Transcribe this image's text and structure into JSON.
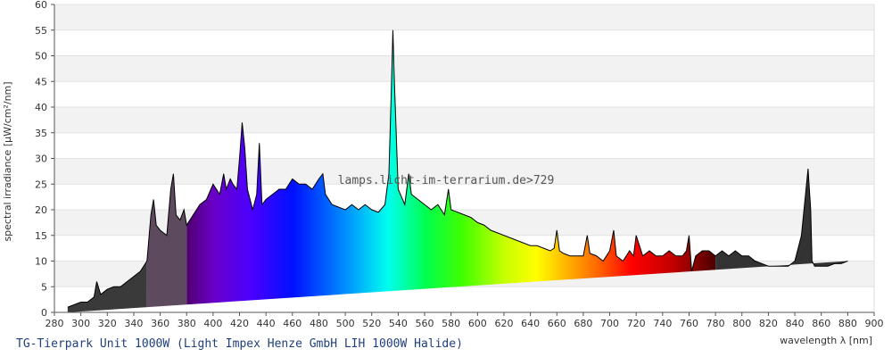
{
  "chart_data": {
    "type": "area",
    "xlabel": "wavelength λ [nm]",
    "ylabel": "spectral irradiance [µW/cm²/nm]",
    "xlim": [
      280,
      900
    ],
    "ylim": [
      0,
      60
    ],
    "x_ticks": [
      280,
      300,
      320,
      340,
      360,
      380,
      400,
      420,
      440,
      460,
      480,
      500,
      520,
      540,
      560,
      580,
      600,
      620,
      640,
      660,
      680,
      700,
      720,
      740,
      760,
      780,
      800,
      820,
      840,
      860,
      880,
      900
    ],
    "y_ticks": [
      0,
      5,
      10,
      15,
      20,
      25,
      30,
      35,
      40,
      45,
      50,
      55,
      60
    ],
    "grid": true,
    "watermark": "lamps.licht-im-terrarium.de>729",
    "caption": "TG-Tierpark Unit 1000W (Light Impex Henze GmbH LIH 1000W Halide)",
    "x": [
      290,
      295,
      300,
      305,
      310,
      312,
      315,
      320,
      325,
      330,
      335,
      340,
      345,
      350,
      353,
      355,
      357,
      360,
      365,
      368,
      370,
      372,
      375,
      378,
      380,
      385,
      390,
      395,
      400,
      405,
      408,
      410,
      413,
      415,
      418,
      420,
      422,
      424,
      426,
      430,
      433,
      435,
      437,
      440,
      445,
      450,
      455,
      460,
      465,
      470,
      475,
      480,
      483,
      485,
      490,
      495,
      500,
      505,
      510,
      515,
      520,
      525,
      530,
      533,
      535,
      536,
      537,
      540,
      545,
      548,
      550,
      555,
      560,
      565,
      570,
      575,
      578,
      580,
      585,
      590,
      595,
      600,
      605,
      610,
      615,
      620,
      625,
      630,
      635,
      640,
      645,
      650,
      655,
      658,
      660,
      662,
      665,
      670,
      675,
      680,
      683,
      685,
      690,
      695,
      700,
      703,
      705,
      710,
      715,
      718,
      720,
      725,
      730,
      735,
      740,
      745,
      750,
      755,
      758,
      760,
      762,
      765,
      770,
      775,
      780,
      785,
      790,
      795,
      800,
      805,
      810,
      815,
      820,
      825,
      830,
      835,
      840,
      845,
      850,
      852,
      853,
      855,
      858,
      860,
      865,
      870,
      875,
      880,
      885,
      889
    ],
    "y": [
      1,
      1.5,
      2,
      2,
      3,
      6,
      3.5,
      4.5,
      5,
      5,
      6,
      7,
      8,
      10,
      19,
      22,
      17,
      16,
      15,
      24,
      27,
      19,
      18,
      20,
      17,
      19,
      21,
      22,
      25,
      23,
      27,
      24,
      26,
      25,
      24,
      30,
      37,
      32,
      24,
      20,
      23,
      33,
      21,
      22,
      23,
      24,
      24,
      26,
      25,
      25,
      24,
      26,
      27,
      23,
      21,
      20.5,
      20,
      21,
      20,
      21,
      20,
      19.5,
      21,
      27,
      45,
      55,
      46,
      24,
      21,
      27,
      23,
      22,
      21,
      20,
      21,
      19,
      24,
      20,
      19.5,
      19,
      18.5,
      17.5,
      17,
      16,
      15.5,
      15,
      14.5,
      14,
      13.5,
      13,
      13,
      12.5,
      12,
      12.5,
      16,
      12,
      11.5,
      11,
      11,
      11,
      15,
      11.5,
      11,
      10,
      12,
      16,
      11,
      10,
      12,
      11,
      15,
      11,
      12,
      11,
      11,
      12,
      11,
      11,
      12,
      15,
      8,
      11,
      12,
      12,
      11,
      12,
      11,
      12,
      11,
      11,
      10,
      9.5,
      9,
      9,
      9,
      9,
      10,
      15,
      28,
      20,
      10,
      9,
      9,
      9,
      9,
      9.5,
      9.5,
      10
    ]
  }
}
